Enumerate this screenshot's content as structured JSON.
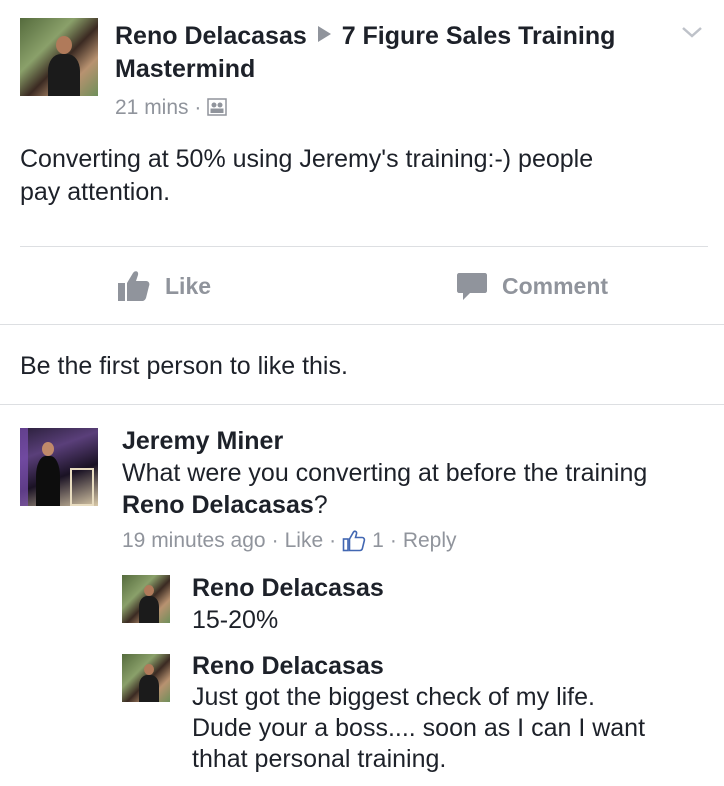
{
  "post": {
    "author": "Reno Delacasas",
    "group": "7 Figure Sales Training Mastermind",
    "group_line1": "7 Figure Sales Training",
    "group_line2": "Mastermind",
    "time": "21 mins",
    "dot": "·",
    "privacy_icon": "group-privacy-icon",
    "body_line1": "Converting at 50% using Jeremy's training:-) people",
    "body_line2": "pay attention."
  },
  "actions": {
    "like_label": "Like",
    "comment_label": "Comment"
  },
  "reactions_summary": "Be the first person to like this.",
  "comments": [
    {
      "author": "Jeremy Miner",
      "text_line1": "What were you converting at before the training",
      "mention": "Reno Delacasas",
      "mention_suffix": "?",
      "meta_time": "19 minutes ago",
      "meta_like": "Like",
      "meta_like_count": "1",
      "meta_reply": "Reply",
      "dot": "·"
    }
  ],
  "replies": [
    {
      "author": "Reno Delacasas",
      "text": "15-20%"
    },
    {
      "author": "Reno Delacasas",
      "text_line1": "Just got the biggest check of my life.",
      "text_line2": "Dude your a boss.... soon as I can I want",
      "text_line3": "thhat personal training."
    }
  ],
  "colors": {
    "text": "#1d2129",
    "meta": "#90949c",
    "divider": "#dddfe2"
  }
}
